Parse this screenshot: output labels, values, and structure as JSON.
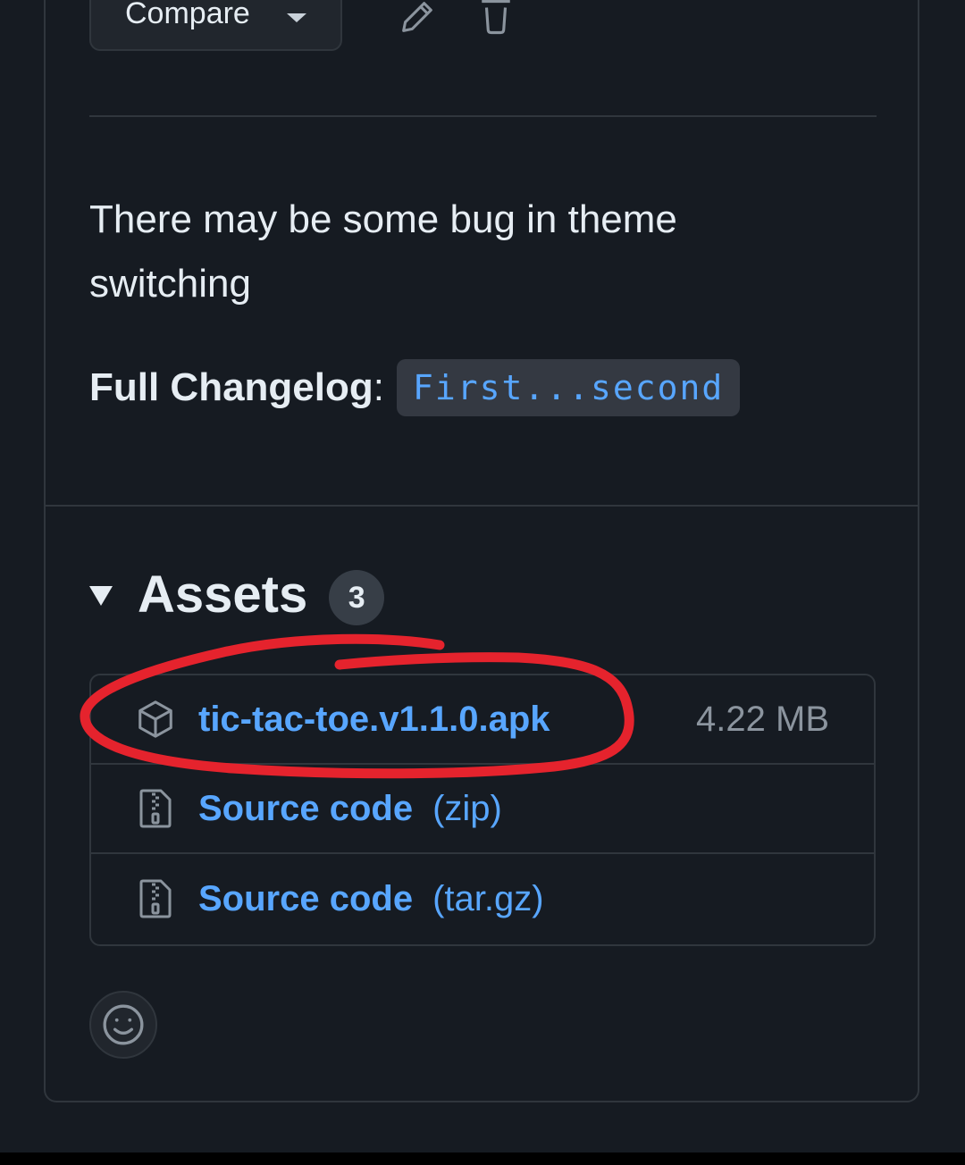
{
  "toolbar": {
    "compare_label": "Compare",
    "edit_icon": "pencil-icon",
    "delete_icon": "trash-icon"
  },
  "release": {
    "notes": "There may be some bug in theme switching",
    "changelog_label": "Full Changelog",
    "changelog_colon": ":",
    "changelog_link": "First...second"
  },
  "assets": {
    "title": "Assets",
    "count": "3",
    "items": [
      {
        "icon": "package-icon",
        "name": "tic-tac-toe.v1.1.0.apk",
        "ext": "",
        "size": "4.22 MB"
      },
      {
        "icon": "file-zip-icon",
        "name": "Source code",
        "ext": "(zip)",
        "size": ""
      },
      {
        "icon": "file-zip-icon",
        "name": "Source code",
        "ext": "(tar.gz)",
        "size": ""
      }
    ]
  },
  "reactions": {
    "icon": "smiley-icon"
  },
  "colors": {
    "background": "#161b22",
    "border": "#30363d",
    "link": "#58a6ff",
    "annotation": "#e5232d"
  }
}
